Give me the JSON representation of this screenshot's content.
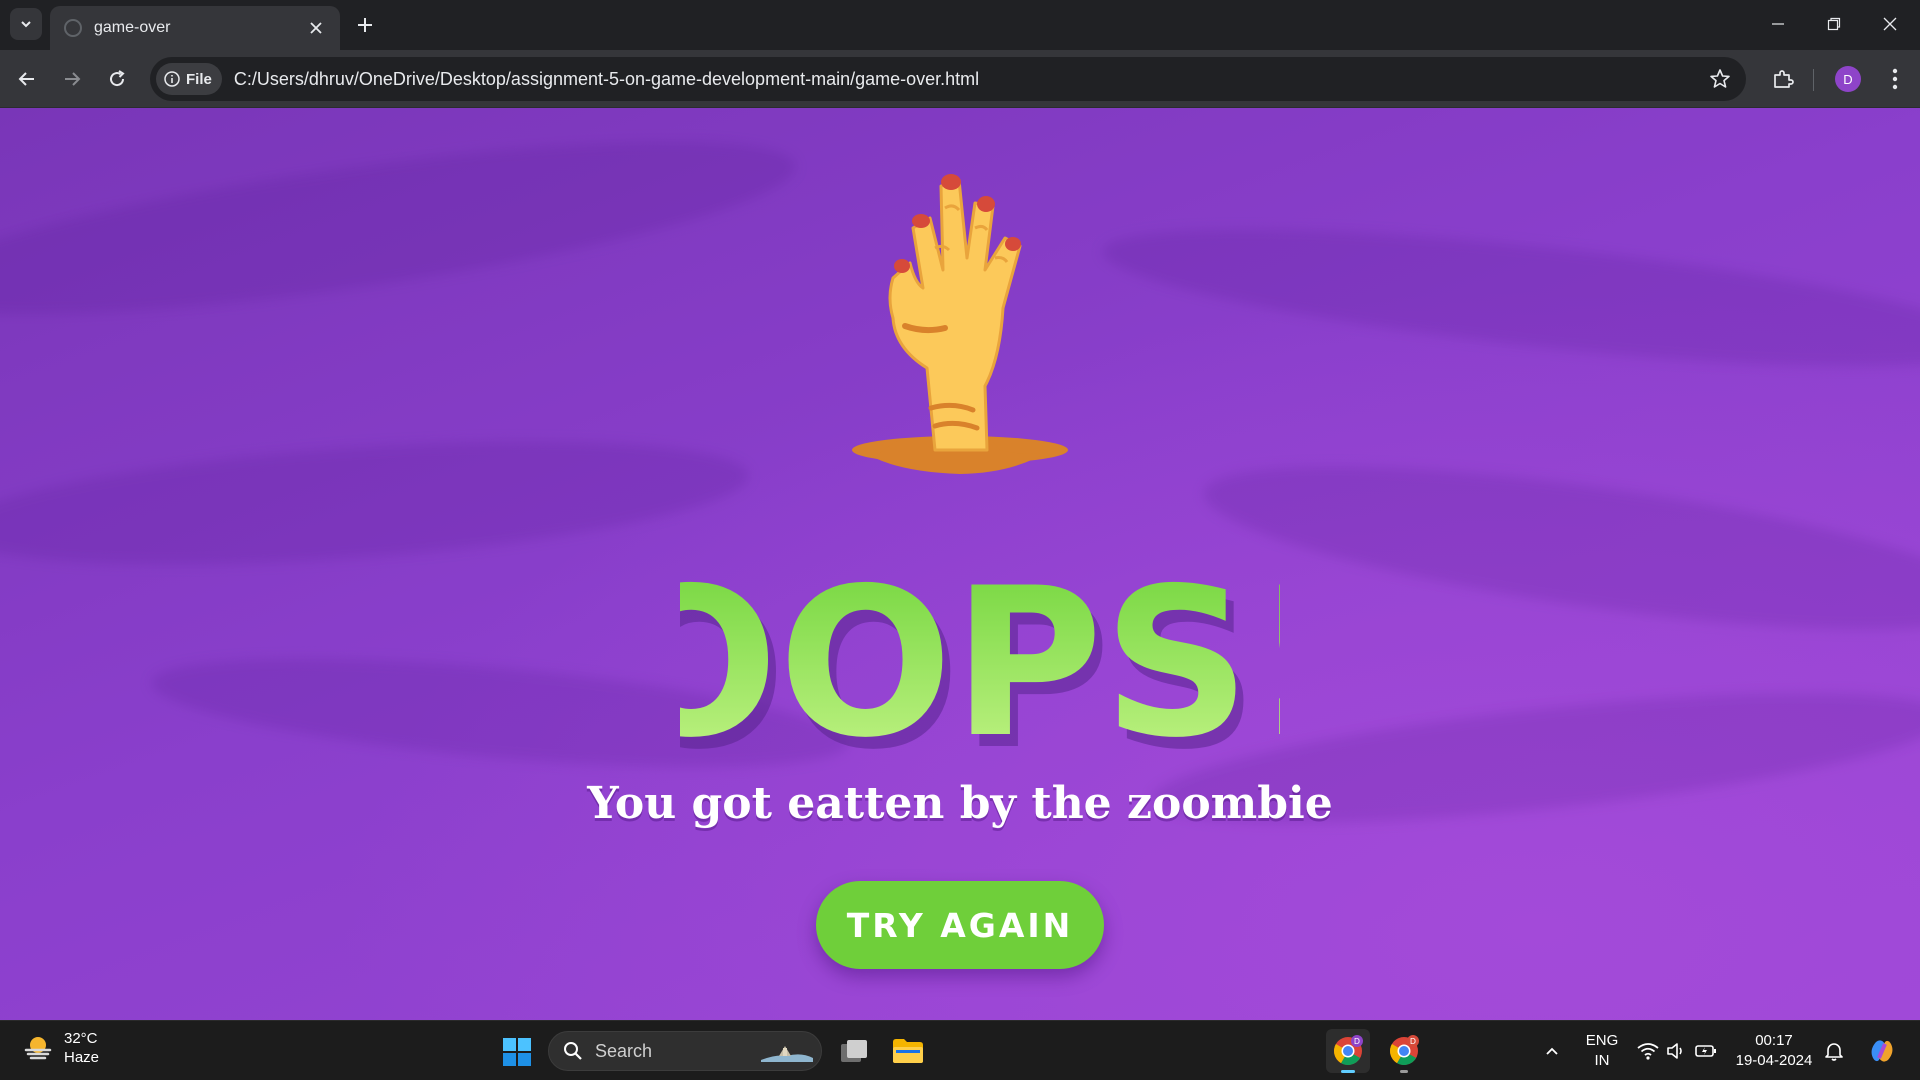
{
  "browser": {
    "tab": {
      "title": "game-over"
    },
    "omnibox": {
      "chip_label": "File",
      "url": "C:/Users/dhruv/OneDrive/Desktop/assignment-5-on-game-development-main/game-over.html"
    },
    "profile_initial": "D"
  },
  "page": {
    "headline": "OOPS!",
    "message": "You got eatten by the zoombie",
    "try_again_label": "TRY AGAIN",
    "colors": {
      "background": "#8a3fcc",
      "headline_green": "#8fe04a",
      "button_green": "#6fcf3a",
      "hand_yellow": "#fcc95a"
    }
  },
  "taskbar": {
    "weather": {
      "temp": "32°C",
      "condition": "Haze"
    },
    "search_placeholder": "Search",
    "language": {
      "line1": "ENG",
      "line2": "IN"
    },
    "clock": {
      "time": "00:17",
      "date": "19-04-2024"
    },
    "pinned": [
      "windows-start-icon",
      "file-explorer-icon",
      "chrome-icon",
      "chrome-profile-icon"
    ]
  }
}
